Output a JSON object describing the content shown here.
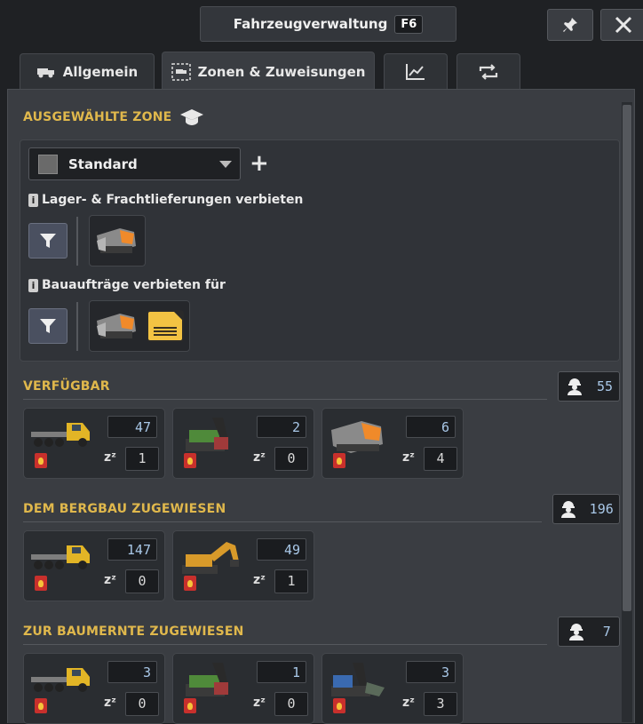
{
  "window": {
    "title": "Fahrzeugverwaltung",
    "hotkey": "F6"
  },
  "top_buttons": {
    "pin_icon": "pin-icon",
    "close_icon": "close-icon"
  },
  "tabs": [
    {
      "label": "Allgemein",
      "icon": "truck-icon",
      "active": false
    },
    {
      "label": "Zonen & Zuweisungen",
      "icon": "zone-truck-icon",
      "active": true
    },
    {
      "label": "",
      "icon": "chart-icon",
      "active": false
    },
    {
      "label": "",
      "icon": "repeat-icon",
      "active": false
    }
  ],
  "zone": {
    "section_title": "AUSGEWÄHLTE ZONE",
    "selected": "Standard",
    "storage_label": "Lager- & Frachtlieferungen verbieten",
    "construction_label": "Bauaufträge verbieten für",
    "accent": "#e0b84c"
  },
  "sections": [
    {
      "title": "VERFÜGBAR",
      "workers": "55",
      "vehicles": [
        {
          "type": "truck",
          "count": "47",
          "idle": "1"
        },
        {
          "type": "excavator-green",
          "count": "2",
          "idle": "0"
        },
        {
          "type": "dozer",
          "count": "6",
          "idle": "4"
        }
      ]
    },
    {
      "title": "DEM BERGBAU ZUGEWIESEN",
      "workers": "196",
      "vehicles": [
        {
          "type": "truck",
          "count": "147",
          "idle": "0"
        },
        {
          "type": "excavator-yellow",
          "count": "49",
          "idle": "1"
        }
      ]
    },
    {
      "title": "ZUR BAUMERNTE ZUGEWIESEN",
      "workers": "7",
      "vehicles": [
        {
          "type": "truck",
          "count": "3",
          "idle": "0"
        },
        {
          "type": "excavator-green",
          "count": "1",
          "idle": "0"
        },
        {
          "type": "tree-harvester",
          "count": "3",
          "idle": "3"
        }
      ]
    }
  ],
  "idle_symbol": "zᶻ"
}
